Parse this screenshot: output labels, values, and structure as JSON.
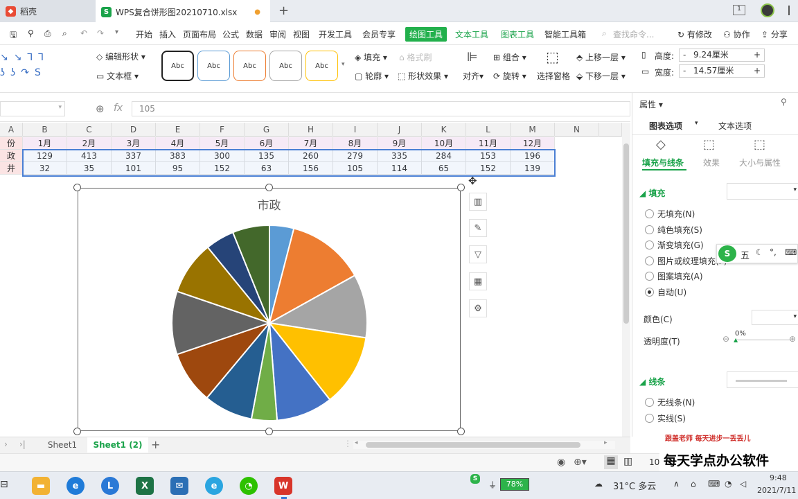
{
  "tabs": [
    {
      "label": "稻壳",
      "icon": "daoke-icon",
      "color": "#e94b35"
    },
    {
      "label": "WPS复合饼形图20210710.xlsx",
      "icon": "wps-sheet-icon",
      "color": "#1aa34a"
    }
  ],
  "new_tab": "+",
  "menu": [
    "开始",
    "插入",
    "页面布局",
    "公式",
    "数据",
    "审阅",
    "视图",
    "开发工具",
    "会员专享",
    "绘图工具",
    "文本工具",
    "图表工具",
    "智能工具箱"
  ],
  "menu_active": "绘图工具",
  "search_placeholder": "查找命令...",
  "menu_right": {
    "changes": "有修改",
    "collab": "协作",
    "share": "分享"
  },
  "toolbar": {
    "edit_shape": "编辑形状",
    "textbox": "文本框",
    "style_label": "Abc",
    "fill": "填充",
    "format_brush": "格式刷",
    "outline": "轮廓",
    "shape_effect": "形状效果",
    "align": "对齐",
    "group": "组合",
    "rotate": "旋转",
    "select_pane": "选择窗格",
    "bring_forward": "上移一层",
    "send_backward": "下移一层",
    "height_label": "高度:",
    "height_value": "9.24厘米",
    "width_label": "宽度:",
    "width_value": "14.57厘米",
    "minus": "-",
    "plus": "+"
  },
  "formula": {
    "fx": "fx",
    "value": "105"
  },
  "columns": [
    "A",
    "B",
    "C",
    "D",
    "E",
    "F",
    "G",
    "H",
    "I",
    "J",
    "K",
    "L",
    "M",
    "N"
  ],
  "rows": [
    {
      "label": "份",
      "values": [
        "1月",
        "2月",
        "3月",
        "4月",
        "5月",
        "6月",
        "7月",
        "8月",
        "9月",
        "10月",
        "11月",
        "12月"
      ]
    },
    {
      "label": "政",
      "values": [
        "129",
        "413",
        "337",
        "383",
        "300",
        "135",
        "260",
        "279",
        "335",
        "284",
        "153",
        "196"
      ]
    },
    {
      "label": "井",
      "values": [
        "32",
        "35",
        "101",
        "95",
        "152",
        "63",
        "156",
        "105",
        "114",
        "65",
        "152",
        "139"
      ]
    }
  ],
  "chart_data": {
    "type": "pie",
    "title": "市政",
    "categories": [
      "1月",
      "2月",
      "3月",
      "4月",
      "5月",
      "6月",
      "7月",
      "8月",
      "9月",
      "10月",
      "11月",
      "12月"
    ],
    "values": [
      129,
      413,
      337,
      383,
      300,
      135,
      260,
      279,
      335,
      284,
      153,
      196
    ],
    "colors": [
      "#5b9bd5",
      "#ed7d31",
      "#a5a5a5",
      "#ffc000",
      "#4472c4",
      "#70ad47",
      "#255e91",
      "#9e480e",
      "#636363",
      "#997300",
      "#264478",
      "#43682b"
    ]
  },
  "chart_side_buttons": [
    {
      "name": "chart-elements-icon",
      "glyph": "▥"
    },
    {
      "name": "chart-style-icon",
      "glyph": "✎"
    },
    {
      "name": "chart-filter-icon",
      "glyph": "▽"
    },
    {
      "name": "chart-data-icon",
      "glyph": "▦"
    },
    {
      "name": "chart-settings-icon",
      "glyph": "⚙"
    }
  ],
  "pane": {
    "title": "属性",
    "tab_chart": "图表选项",
    "tab_text": "文本选项",
    "sub_fill_line": "填充与线条",
    "sub_effect": "效果",
    "sub_size": "大小与属性",
    "fill_section": "填充",
    "fill_options": [
      "无填充(N)",
      "纯色填充(S)",
      "渐变填充(G)",
      "图片或纹理填充(P)",
      "图案填充(A)",
      "自动(U)"
    ],
    "fill_selected": 5,
    "color_label": "颜色(C)",
    "transparency_label": "透明度(T)",
    "transparency_value": "0%",
    "line_section": "线条",
    "line_options": [
      "无线条(N)",
      "实线(S)"
    ]
  },
  "ime": {
    "mode": "五"
  },
  "sheets": [
    "Sheet1",
    "Sheet1 (2)"
  ],
  "active_sheet": 1,
  "add_sheet": "+",
  "status": {
    "zoom": "10"
  },
  "watermark": {
    "line1": "跟盖老师 每天进步一丢丢儿",
    "line2": "每天学点办公软件"
  },
  "taskbar": {
    "battery": "78%",
    "weather": "31°C 多云",
    "time": "9:48",
    "date": "2021/7/11"
  }
}
